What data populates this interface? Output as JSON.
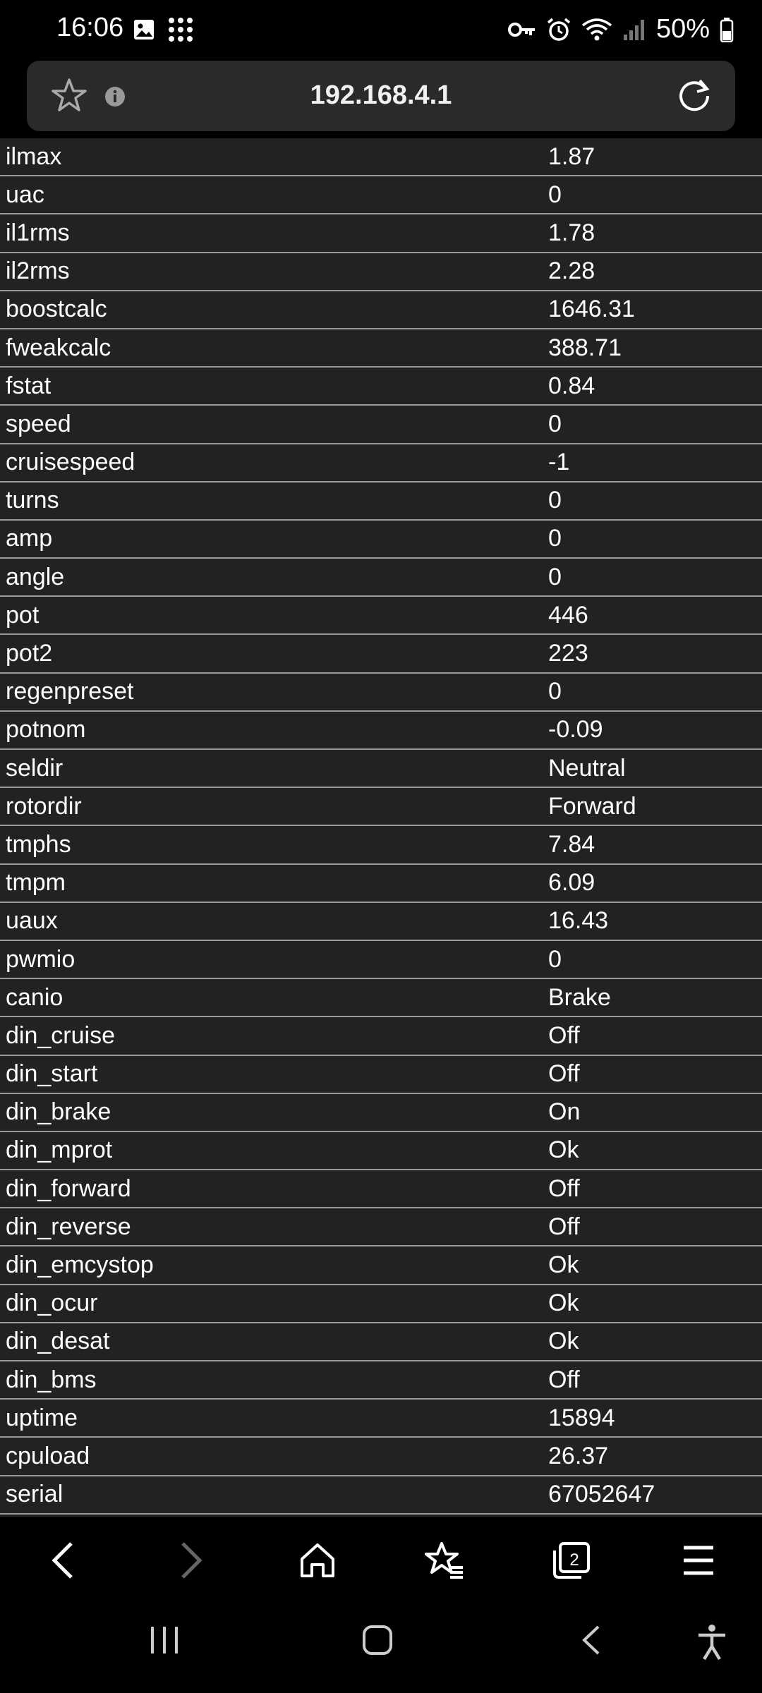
{
  "status_bar": {
    "time": "16:06",
    "battery": "50%",
    "icons": [
      "gallery-icon",
      "apps-grid-icon",
      "vpn-key-icon",
      "alarm-icon",
      "wifi-icon",
      "signal-icon",
      "battery-icon"
    ]
  },
  "url_bar": {
    "url": "192.168.4.1",
    "icons": [
      "star-icon",
      "info-icon",
      "reload-icon"
    ]
  },
  "rows": [
    {
      "key": "ilmax",
      "value": "1.87"
    },
    {
      "key": "uac",
      "value": "0"
    },
    {
      "key": "il1rms",
      "value": "1.78"
    },
    {
      "key": "il2rms",
      "value": "2.28"
    },
    {
      "key": "boostcalc",
      "value": "1646.31"
    },
    {
      "key": "fweakcalc",
      "value": "388.71"
    },
    {
      "key": "fstat",
      "value": "0.84"
    },
    {
      "key": "speed",
      "value": "0"
    },
    {
      "key": "cruisespeed",
      "value": "-1"
    },
    {
      "key": "turns",
      "value": "0"
    },
    {
      "key": "amp",
      "value": "0"
    },
    {
      "key": "angle",
      "value": "0"
    },
    {
      "key": "pot",
      "value": "446"
    },
    {
      "key": "pot2",
      "value": "223"
    },
    {
      "key": "regenpreset",
      "value": "0"
    },
    {
      "key": "potnom",
      "value": "-0.09"
    },
    {
      "key": "seldir",
      "value": "Neutral"
    },
    {
      "key": "rotordir",
      "value": "Forward"
    },
    {
      "key": "tmphs",
      "value": "7.84"
    },
    {
      "key": "tmpm",
      "value": "6.09"
    },
    {
      "key": "uaux",
      "value": "16.43"
    },
    {
      "key": "pwmio",
      "value": "0"
    },
    {
      "key": "canio",
      "value": "Brake"
    },
    {
      "key": "din_cruise",
      "value": "Off"
    },
    {
      "key": "din_start",
      "value": "Off"
    },
    {
      "key": "din_brake",
      "value": "On"
    },
    {
      "key": "din_mprot",
      "value": "Ok"
    },
    {
      "key": "din_forward",
      "value": "Off"
    },
    {
      "key": "din_reverse",
      "value": "Off"
    },
    {
      "key": "din_emcystop",
      "value": "Ok"
    },
    {
      "key": "din_ocur",
      "value": "Ok"
    },
    {
      "key": "din_desat",
      "value": "Ok"
    },
    {
      "key": "din_bms",
      "value": "Off"
    },
    {
      "key": "uptime",
      "value": "15894"
    },
    {
      "key": "cpuload",
      "value": "26.37"
    },
    {
      "key": "serial",
      "value": "67052647"
    }
  ],
  "toolbar": {
    "tabs_count": "2",
    "icons": [
      "back-icon",
      "forward-icon",
      "home-icon",
      "bookmarks-icon",
      "tabs-icon",
      "menu-icon"
    ]
  },
  "nav_bar": {
    "icons": [
      "recents-icon",
      "home-button-icon",
      "back-nav-icon",
      "accessibility-icon"
    ]
  },
  "colors": {
    "page_bg": "#222222",
    "row_border": "#9a9a9a",
    "chrome_bg": "#000000",
    "url_bar_bg": "#2a2a2c"
  }
}
